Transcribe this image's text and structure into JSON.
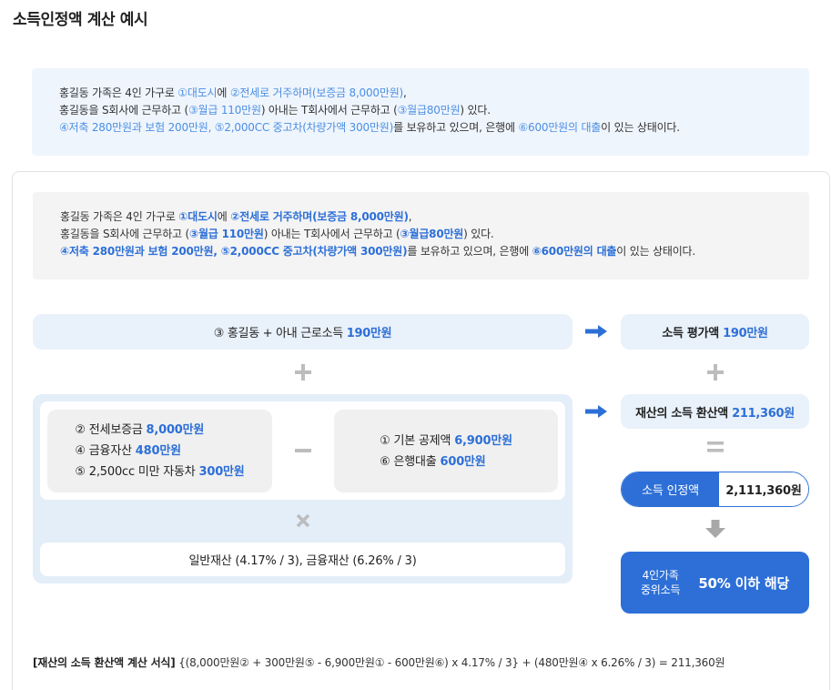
{
  "title": "소득인정액 계산 예시",
  "colors": {
    "accent": "#2d6fd7",
    "notice_blue": "#4b8fe3",
    "notice_bg": "#eff5fd",
    "gray_bg": "#f4f4f4",
    "pill_bg": "#e9f1fa",
    "container_bg": "#e3eef9",
    "inner_gray": "#f0f0f0",
    "operator_gray": "#bdbdbd",
    "arrow_down_gray": "#a8a8a8"
  },
  "icons": {
    "arrow_right": "arrow-right-icon",
    "plus": "plus-icon",
    "minus": "minus-icon",
    "multiply": "multiply-icon",
    "equals": "equals-icon",
    "arrow_down": "arrow-down-icon"
  },
  "summary": {
    "lines": [
      [
        {
          "text": "홍길동 가족은 4인 가구로 ",
          "hl": false
        },
        {
          "text": "①대도시",
          "hl": true
        },
        {
          "text": "에 ",
          "hl": false
        },
        {
          "text": "②전세로 거주하며(보증금 8,000만원)",
          "hl": true
        },
        {
          "text": ",",
          "hl": false
        }
      ],
      [
        {
          "text": "홍길동을 S회사에 근무하고 (",
          "hl": false
        },
        {
          "text": "③월급 110만원",
          "hl": true
        },
        {
          "text": ") 아내는 T회사에서 근무하고 (",
          "hl": false
        },
        {
          "text": "③월급80만원",
          "hl": true
        },
        {
          "text": ") 있다.",
          "hl": false
        }
      ],
      [
        {
          "text": "④저축 280만원과 보험 200만원, ⑤2,000CC 중고차(차량가액 300만원)",
          "hl": true
        },
        {
          "text": "를 보유하고 있으며, 은행에 ",
          "hl": false
        },
        {
          "text": "⑥600만원의 대출",
          "hl": true
        },
        {
          "text": "이 있는 상태이다.",
          "hl": false
        }
      ]
    ]
  },
  "scenario": {
    "lines": [
      [
        {
          "text": "홍길동 가족은 4인 가구로 ",
          "hl": false
        },
        {
          "text": "①대도시",
          "hl": true
        },
        {
          "text": "에 ",
          "hl": false
        },
        {
          "text": "②전세로 거주하며(보증금 8,000만원)",
          "hl": true
        },
        {
          "text": ",",
          "hl": false
        }
      ],
      [
        {
          "text": "홍길동을 S회사에 근무하고 (",
          "hl": false
        },
        {
          "text": "③월급 110만원",
          "hl": true
        },
        {
          "text": ") 아내는 T회사에서 근무하고 (",
          "hl": false
        },
        {
          "text": "③월급80만원",
          "hl": true
        },
        {
          "text": ") 있다.",
          "hl": false
        }
      ],
      [
        {
          "text": "④저축 280만원과 보험 200만원, ⑤2,000CC 중고차(차량가액 300만원)",
          "hl": true
        },
        {
          "text": "를 보유하고 있으며, 은행에 ",
          "hl": false
        },
        {
          "text": "⑥600만원의 대출",
          "hl": true
        },
        {
          "text": "이 있는 상태이다.",
          "hl": false
        }
      ]
    ]
  },
  "diagram": {
    "earned_income": {
      "label": "③ 홍길동 + 아내 근로소득",
      "amount": "190만원"
    },
    "income_evaluation": {
      "label": "소득 평가액",
      "amount": "190만원"
    },
    "property": {
      "assets": [
        {
          "label": "② 전세보증금",
          "amount": "8,000만원"
        },
        {
          "label": "④ 금융자산",
          "amount": "480만원"
        },
        {
          "label": "⑤ 2,500cc 미만 자동차",
          "amount": "300만원"
        }
      ],
      "deductions": [
        {
          "label": "① 기본 공제액",
          "amount": "6,900만원"
        },
        {
          "label": "⑥ 은행대출",
          "amount": "600만원"
        }
      ],
      "conversion_rates": "일반재산 (4.17% / 3), 금융재산 (6.26% / 3)"
    },
    "property_income": {
      "label": "재산의 소득 환산액",
      "amount": "211,360원"
    },
    "income_recognized": {
      "label": "소득 인정액",
      "amount": "2,111,360원"
    },
    "result": {
      "group_line1": "4인가족",
      "group_line2": "중위소득",
      "verdict": "50% 이하 해당"
    }
  },
  "formula": {
    "label": "[재산의 소득 환산액 계산 서식]",
    "expression": "{(8,000만원② + 300만원⑤ - 6,900만원① - 600만원⑥) x 4.17% / 3} + (480만원④ x 6.26% / 3) = 211,360원"
  }
}
